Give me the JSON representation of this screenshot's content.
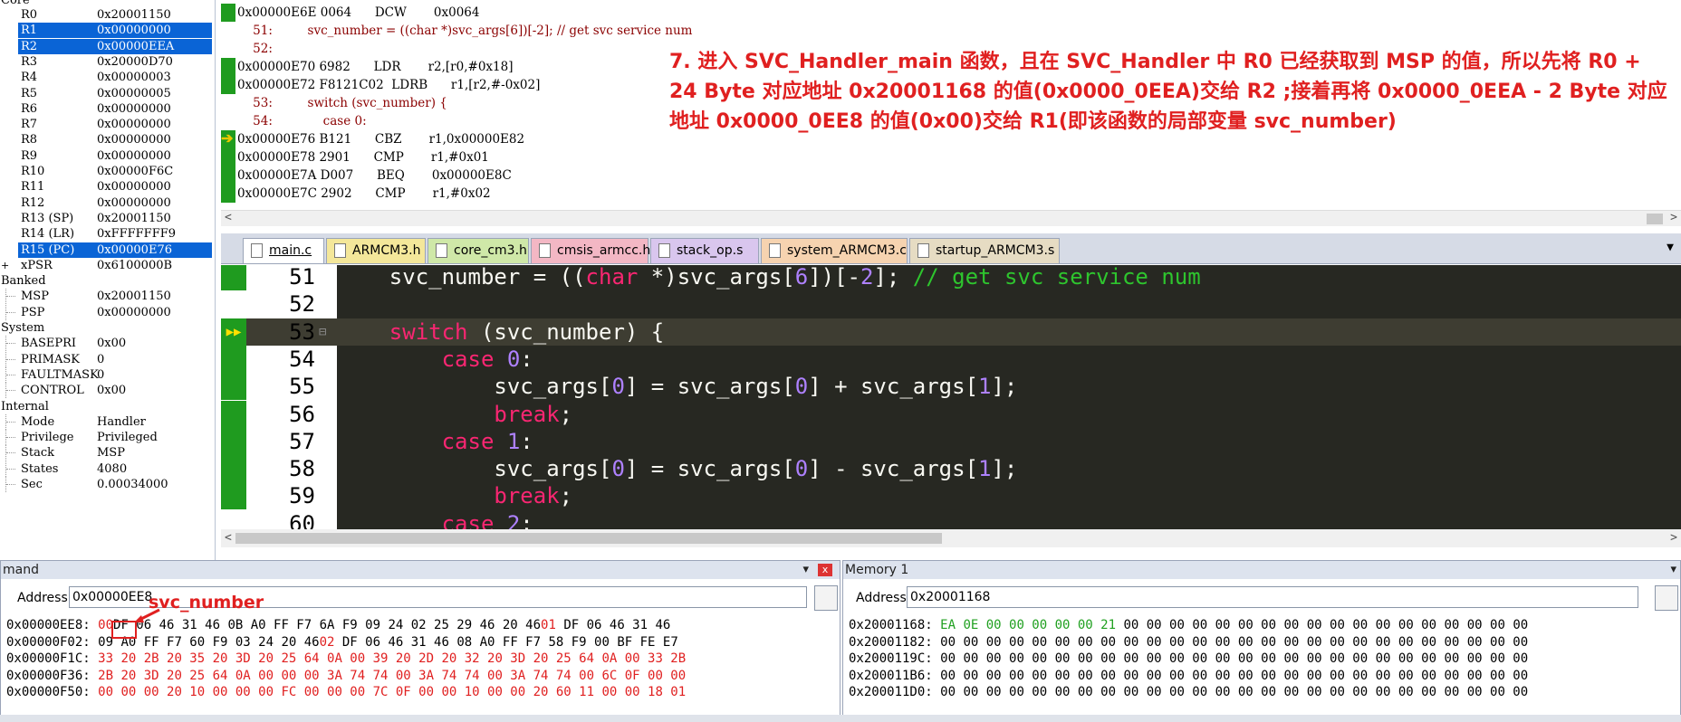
{
  "registers": {
    "top_clip": "Core",
    "rows": [
      {
        "name": "R0",
        "value": "0x20001150"
      },
      {
        "name": "R1",
        "value": "0x00000000",
        "selected": true
      },
      {
        "name": "R2",
        "value": "0x00000EEA",
        "selected": true
      },
      {
        "name": "R3",
        "value": "0x20000D70"
      },
      {
        "name": "R4",
        "value": "0x00000003"
      },
      {
        "name": "R5",
        "value": "0x00000005"
      },
      {
        "name": "R6",
        "value": "0x00000000"
      },
      {
        "name": "R7",
        "value": "0x00000000"
      },
      {
        "name": "R8",
        "value": "0x00000000"
      },
      {
        "name": "R9",
        "value": "0x00000000"
      },
      {
        "name": "R10",
        "value": "0x00000F6C"
      },
      {
        "name": "R11",
        "value": "0x00000000"
      },
      {
        "name": "R12",
        "value": "0x00000000"
      },
      {
        "name": "R13 (SP)",
        "value": "0x20001150"
      },
      {
        "name": "R14 (LR)",
        "value": "0xFFFFFFF9"
      },
      {
        "name": "R15 (PC)",
        "value": "0x00000E76",
        "selected": true
      },
      {
        "name": "xPSR",
        "value": "0x6100000B",
        "expander": "+"
      }
    ],
    "groups": [
      {
        "title": "Banked",
        "items": [
          {
            "name": "MSP",
            "value": "0x20001150"
          },
          {
            "name": "PSP",
            "value": "0x00000000"
          }
        ]
      },
      {
        "title": "System",
        "items": [
          {
            "name": "BASEPRI",
            "value": "0x00"
          },
          {
            "name": "PRIMASK",
            "value": "0"
          },
          {
            "name": "FAULTMASK",
            "value": "0"
          },
          {
            "name": "CONTROL",
            "value": "0x00"
          }
        ]
      },
      {
        "title": "Internal",
        "items": [
          {
            "name": "Mode",
            "value": "Handler"
          },
          {
            "name": "Privilege",
            "value": "Privileged"
          },
          {
            "name": "Stack",
            "value": "MSP"
          },
          {
            "name": "States",
            "value": "4080"
          },
          {
            "name": "Sec",
            "value": "0.00034000"
          }
        ]
      }
    ]
  },
  "disassembly": {
    "lines": [
      {
        "text": "0x00000E6E 0064      DCW       0x0064",
        "kind": "addr"
      },
      {
        "text": "    51:         svc_number = ((char *)svc_args[6])[-2]; // get svc service num",
        "kind": "src"
      },
      {
        "text": "    52:",
        "kind": "src"
      },
      {
        "text": "0x00000E70 6982      LDR       r2,[r0,#0x18]",
        "kind": "addr"
      },
      {
        "text": "0x00000E72 F8121C02  LDRB      r1,[r2,#-0x02]",
        "kind": "addr"
      },
      {
        "text": "    53:         switch (svc_number) {",
        "kind": "src"
      },
      {
        "text": "    54:             case 0:",
        "kind": "src"
      },
      {
        "text": "0x00000E76 B121      CBZ       r1,0x00000E82",
        "kind": "addr",
        "current": true
      },
      {
        "text": "0x00000E78 2901      CMP       r1,#0x01",
        "kind": "addr"
      },
      {
        "text": "0x00000E7A D007      BEQ       0x00000E8C",
        "kind": "addr"
      },
      {
        "text": "0x00000E7C 2902      CMP       r1,#0x02",
        "kind": "addr"
      }
    ]
  },
  "annotation": {
    "text": "7. 进入 SVC_Handler_main 函数，且在 SVC_Handler 中 R0 已经获取到 MSP 的值，所以先将 R0 + 24 Byte 对应地址 0x20001168 的值(0x0000_0EEA)交给 R2 ;接着再将 0x0000_0EEA - 2 Byte 对应地址 0x0000_0EE8 的值(0x00)交给 R1(即该函数的局部变量 svc_number)"
  },
  "tabs": [
    {
      "label": "main.c",
      "active": true,
      "color": "#ffffff"
    },
    {
      "label": "ARMCM3.h",
      "color": "#f4e79a"
    },
    {
      "label": "core_cm3.h",
      "color": "#cfe8a8"
    },
    {
      "label": "cmsis_armcc.h",
      "color": "#f3b7c4"
    },
    {
      "label": "stack_op.s",
      "color": "#d9c6ee"
    },
    {
      "label": "system_ARMCM3.c",
      "color": "#f6d3b0"
    },
    {
      "label": "startup_ARMCM3.s",
      "color": "#e6dcc3"
    }
  ],
  "editor": {
    "lines": [
      {
        "num": "51",
        "green": true
      },
      {
        "num": "52",
        "green": false
      },
      {
        "num": "53",
        "green": false,
        "current": true
      },
      {
        "num": "54",
        "green": true
      },
      {
        "num": "55",
        "green": true
      },
      {
        "num": "56",
        "green": true
      },
      {
        "num": "57",
        "green": true
      },
      {
        "num": "58",
        "green": true
      },
      {
        "num": "59",
        "green": true
      },
      {
        "num": "60",
        "green": false
      }
    ],
    "code": [
      [
        [
          "",
          "    svc_number = (("
        ],
        [
          "kw",
          "char"
        ],
        [
          "",
          " *)svc_args["
        ],
        [
          "num",
          "6"
        ],
        [
          "",
          "])[-"
        ],
        [
          "num",
          "2"
        ],
        [
          "",
          "]; "
        ],
        [
          "cm",
          "// get svc service num"
        ]
      ],
      [],
      [
        [
          "kw",
          "    switch"
        ],
        [
          "",
          " (svc_number) {"
        ]
      ],
      [
        [
          "kw",
          "        case"
        ],
        [
          "",
          ""
        ],
        [
          "num",
          " 0"
        ],
        [
          "",
          ":"
        ]
      ],
      [
        [
          "",
          "            svc_args["
        ],
        [
          "num",
          "0"
        ],
        [
          "",
          "] = svc_args["
        ],
        [
          "num",
          "0"
        ],
        [
          "",
          "] + svc_args["
        ],
        [
          "num",
          "1"
        ],
        [
          "",
          "];"
        ]
      ],
      [
        [
          "kw",
          "            break"
        ],
        [
          "",
          ";"
        ]
      ],
      [
        [
          "kw",
          "        case"
        ],
        [
          "num",
          " 1"
        ],
        [
          "",
          ":"
        ]
      ],
      [
        [
          "",
          "            svc_args["
        ],
        [
          "num",
          "0"
        ],
        [
          "",
          "] = svc_args["
        ],
        [
          "num",
          "0"
        ],
        [
          "",
          "] - svc_args["
        ],
        [
          "num",
          "1"
        ],
        [
          "",
          "];"
        ]
      ],
      [
        [
          "kw",
          "            break"
        ],
        [
          "",
          ";"
        ]
      ],
      [
        [
          "kw",
          "        case"
        ],
        [
          "num",
          " 2"
        ],
        [
          "",
          ":"
        ]
      ]
    ]
  },
  "memory_left": {
    "title": "mand",
    "address_label": "Address:",
    "address": "0x00000EE8",
    "callout": "svc_number",
    "lines": [
      {
        "addr": "0x00000EE8:",
        "bytes": [
          [
            "r",
            "00"
          ],
          [
            "",
            "DF 06 46 31 46 0B A0 FF F7 6A F9 09 24 02 25 29 46 20 46"
          ],
          [
            "r",
            "01"
          ],
          [
            "",
            " DF 06 46 31 46"
          ]
        ]
      },
      {
        "addr": "0x00000F02:",
        "bytes": [
          [
            "",
            "09 A0 FF F7 60 F9 03 24 20 46"
          ],
          [
            "r",
            "02"
          ],
          [
            "",
            " DF 06 46 31 46 08 A0 FF F7 58 F9 00 BF FE E7"
          ]
        ]
      },
      {
        "addr": "0x00000F1C:",
        "bytes": [
          [
            "r",
            "33 20 2B 20 35 20 3D 20 25 64 0A 00 39 20 2D 20 32 20 3D 20 25 64 0A 00 33 2B"
          ]
        ]
      },
      {
        "addr": "0x00000F36:",
        "bytes": [
          [
            "r",
            "2B 20 3D 20 25 64 0A 00 00 00 3A 74 74 00 3A 74 74 00 3A 74 74 00 6C 0F 00 00"
          ]
        ]
      },
      {
        "addr": "0x00000F50:",
        "bytes": [
          [
            "r",
            "00 00 00 20 10 00 00 00 FC 00 00 00 7C 0F 00 00 10 00 00 20 60 11 00 00 18 01"
          ]
        ]
      }
    ]
  },
  "memory_right": {
    "title": "Memory 1",
    "address_label": "Address:",
    "address": "0x20001168",
    "lines": [
      {
        "addr": "0x20001168:",
        "bytes": [
          [
            "g",
            "EA 0E 00 00 00 00 00 21"
          ],
          [
            "",
            " 00 00 00 00 00 00 00 00 00 00 00 00 00 00 00 00 00 00"
          ]
        ]
      },
      {
        "addr": "0x20001182:",
        "bytes": [
          [
            "",
            "00 00 00 00 00 00 00 00 00 00 00 00 00 00 00 00 00 00 00 00 00 00 00 00 00 00"
          ]
        ]
      },
      {
        "addr": "0x2000119C:",
        "bytes": [
          [
            "",
            "00 00 00 00 00 00 00 00 00 00 00 00 00 00 00 00 00 00 00 00 00 00 00 00 00 00"
          ]
        ]
      },
      {
        "addr": "0x200011B6:",
        "bytes": [
          [
            "",
            "00 00 00 00 00 00 00 00 00 00 00 00 00 00 00 00 00 00 00 00 00 00 00 00 00 00"
          ]
        ]
      },
      {
        "addr": "0x200011D0:",
        "bytes": [
          [
            "",
            "00 00 00 00 00 00 00 00 00 00 00 00 00 00 00 00 00 00 00 00 00 00 00 00 00 00"
          ]
        ]
      }
    ]
  }
}
